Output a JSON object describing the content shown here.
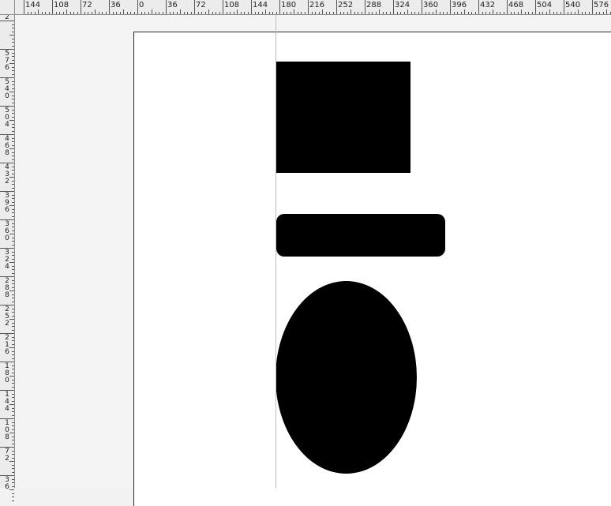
{
  "rulers": {
    "top_labels": [
      "144",
      "108",
      "72",
      "36",
      "0",
      "36",
      "72",
      "108",
      "144",
      "180",
      "216",
      "252",
      "288",
      "324",
      "360",
      "396",
      "432",
      "468",
      "504",
      "540",
      "576"
    ],
    "left_labels": [
      "2",
      "576",
      "540",
      "504",
      "468",
      "432",
      "396",
      "360",
      "324",
      "288",
      "252",
      "216",
      "180",
      "144",
      "108",
      "72",
      "36"
    ]
  },
  "colors": {
    "shape_fill": "#000000",
    "page_background": "#ffffff",
    "pasteboard": "#f4f4f4",
    "guide": "#7fd4e6"
  },
  "shapes": [
    {
      "name": "rectangle"
    },
    {
      "name": "rounded-rectangle"
    },
    {
      "name": "ellipse"
    }
  ]
}
